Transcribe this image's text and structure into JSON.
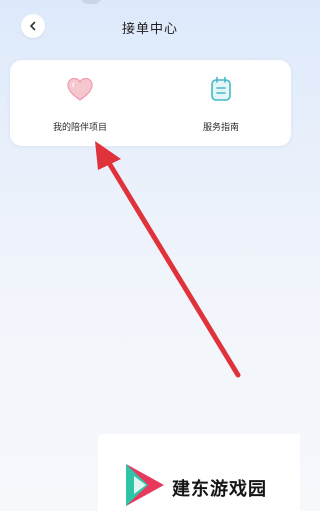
{
  "header": {
    "title": "接单中心",
    "back_icon": "chevron-left-icon"
  },
  "entries": [
    {
      "label": "我的陪伴项目",
      "icon": "heart-icon"
    },
    {
      "label": "服务指南",
      "icon": "notepad-icon"
    }
  ],
  "annotation": {
    "color": "#e0323b"
  },
  "watermark": {
    "text": "建东游戏园"
  },
  "colors": {
    "background": "#e6eefb",
    "heart_fill": "#f6c7cf",
    "guide_icon": "#47b8c6"
  }
}
